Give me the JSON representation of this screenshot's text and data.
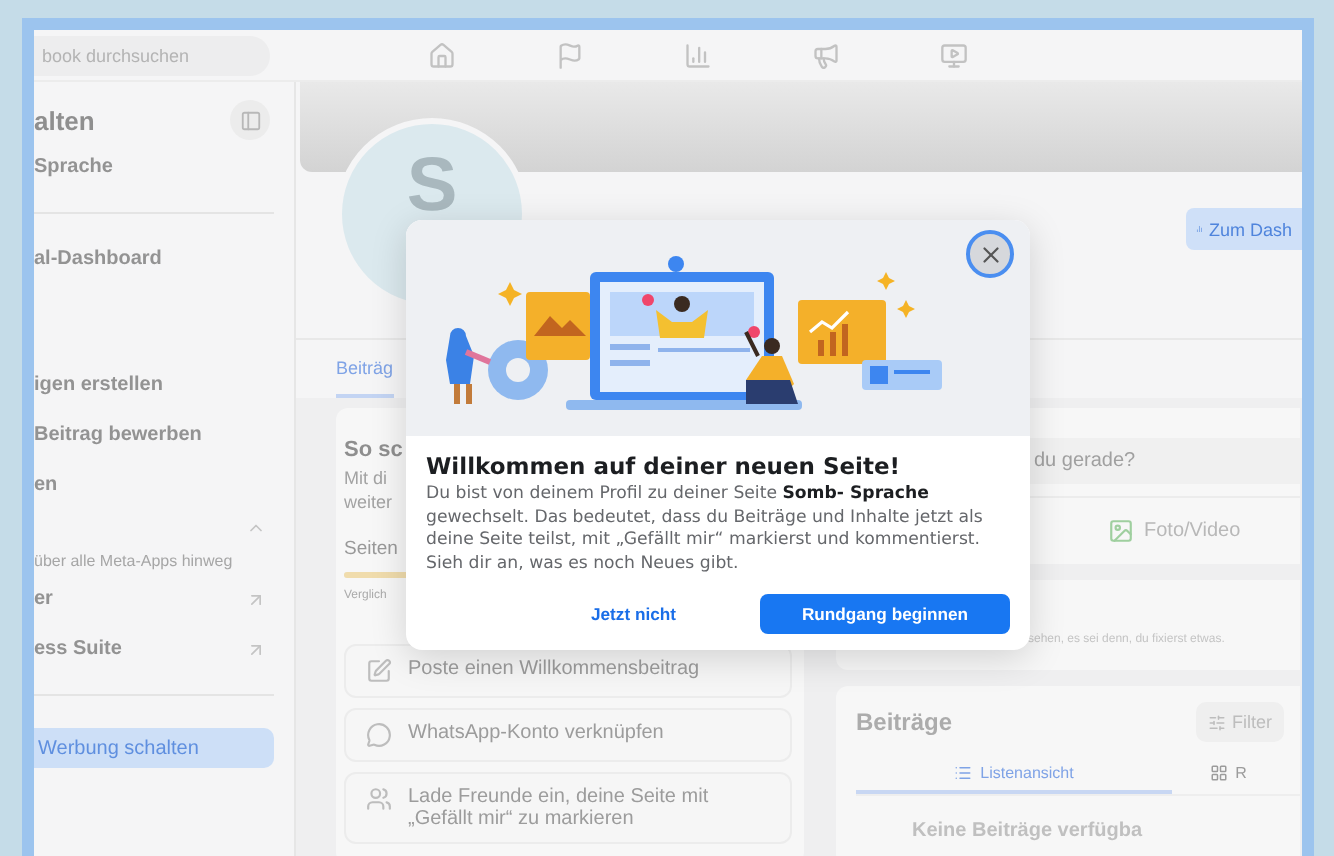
{
  "top_bar": {
    "search": {
      "placeholder": "book durchsuchen"
    },
    "nav_icons": [
      {
        "kind": "home"
      },
      {
        "kind": "flag"
      },
      {
        "kind": "chart"
      },
      {
        "kind": "megaphone"
      },
      {
        "kind": "video"
      }
    ]
  },
  "sidebar": {
    "title": "alten",
    "items": [
      {
        "kind": "link",
        "label": "Sprache"
      },
      {
        "kind": "divider"
      },
      {
        "kind": "link",
        "label": "al-Dashboard"
      },
      {
        "kind": "spacer"
      },
      {
        "kind": "link",
        "label": "igen erstellen"
      },
      {
        "kind": "link",
        "label": "Beitrag bewerben"
      },
      {
        "kind": "link",
        "label": "en"
      },
      {
        "kind": "section",
        "expanded": true
      },
      {
        "kind": "note",
        "label": "über alle Meta-Apps hinweg"
      },
      {
        "kind": "external",
        "label": "er"
      },
      {
        "kind": "external",
        "label": "ess Suite"
      },
      {
        "kind": "divider"
      }
    ],
    "button": "Werbung schalten"
  },
  "page": {
    "avatar_letter": "S",
    "dashboard_button": "Zum Dash",
    "tabs": [
      {
        "label": "Beiträg",
        "selected": true
      }
    ]
  },
  "setup_card": {
    "title": "So sc",
    "subtitle_lines": [
      "Mit di",
      "weiter"
    ],
    "progress_label": "Seiten",
    "level": 0.15,
    "compare_note": "Verglich",
    "tasks": [
      {
        "kind": "edit",
        "label": "Poste einen Willkommensbeitrag"
      },
      {
        "kind": "whatsapp",
        "label": "WhatsApp-Konto verknüpfen"
      },
      {
        "kind": "friends",
        "label": "Lade Freunde ein, deine Seite mit „Gefällt mir“ zu markieren"
      }
    ]
  },
  "composer": {
    "placeholder": "du gerade?",
    "action": "Foto/Video"
  },
  "pinned_note": "sehen, es sei denn, du fixierst etwas.",
  "posts": {
    "title": "Beiträge",
    "filter": "Filter",
    "views": [
      {
        "label": "Listenansicht",
        "kind": "list",
        "selected": true
      },
      {
        "label": "R",
        "kind": "grid",
        "selected": false
      }
    ],
    "empty": "Keine Beiträge verfügba"
  },
  "dialog": {
    "title": "Willkommen auf deiner neuen Seite!",
    "body": "Du bist von deinem Profil zu deiner Seite **Somb- Sprache** gewechselt. Das bedeutet, dass du Beiträge und Inhalte jetzt als deine Seite teilst, mit „Gefällt mir“ markierst und kommentierst. Sieh dir an, was es noch Neues gibt.",
    "secondary": "Jetzt nicht",
    "primary": "Rundgang beginnen"
  }
}
